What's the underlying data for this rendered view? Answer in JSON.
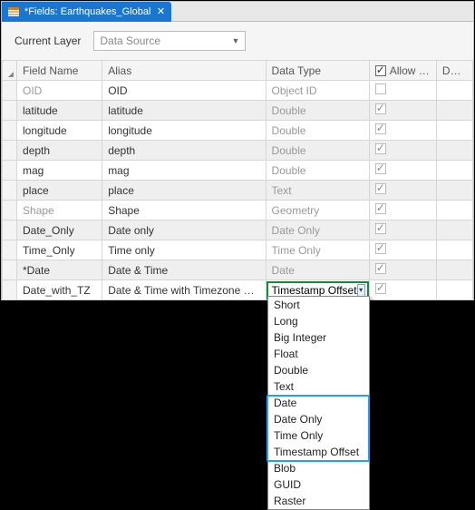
{
  "tab": {
    "title": "*Fields: Earthquakes_Global"
  },
  "toolbar": {
    "current_layer_label": "Current Layer",
    "data_source_value": "Data Source"
  },
  "columns": {
    "field_name": "Field Name",
    "alias": "Alias",
    "data_type": "Data Type",
    "allow_null": "Allow NULL",
    "domain": "Domain"
  },
  "rows": [
    {
      "field": "OID",
      "alias": "OID",
      "type": "Object ID",
      "null": false,
      "fieldDim": true,
      "typeDim": true
    },
    {
      "field": "latitude",
      "alias": "latitude",
      "type": "Double",
      "null": true,
      "fieldDim": false,
      "typeDim": true
    },
    {
      "field": "longitude",
      "alias": "longitude",
      "type": "Double",
      "null": true,
      "fieldDim": false,
      "typeDim": true
    },
    {
      "field": "depth",
      "alias": "depth",
      "type": "Double",
      "null": true,
      "fieldDim": false,
      "typeDim": true
    },
    {
      "field": "mag",
      "alias": "mag",
      "type": "Double",
      "null": true,
      "fieldDim": false,
      "typeDim": true
    },
    {
      "field": "place",
      "alias": "place",
      "type": "Text",
      "null": true,
      "fieldDim": false,
      "typeDim": true
    },
    {
      "field": "Shape",
      "alias": "Shape",
      "type": "Geometry",
      "null": true,
      "fieldDim": true,
      "typeDim": true
    },
    {
      "field": "Date_Only",
      "alias": "Date only",
      "type": "Date Only",
      "null": true,
      "fieldDim": false,
      "typeDim": true
    },
    {
      "field": "Time_Only",
      "alias": "Time only",
      "type": "Time Only",
      "null": true,
      "fieldDim": false,
      "typeDim": true
    },
    {
      "field": "*Date",
      "alias": "Date & Time",
      "type": "Date",
      "null": true,
      "fieldDim": false,
      "typeDim": true
    },
    {
      "field": "Date_with_TZ",
      "alias": "Date & Time with Timezone Offset",
      "type": "Timestamp Offset",
      "null": true,
      "fieldDim": false,
      "typeDim": false,
      "editing": true
    }
  ],
  "dropdown": {
    "items": [
      "Short",
      "Long",
      "Big Integer",
      "Float",
      "Double",
      "Text",
      "Date",
      "Date Only",
      "Time Only",
      "Timestamp Offset",
      "Blob",
      "GUID",
      "Raster"
    ]
  }
}
